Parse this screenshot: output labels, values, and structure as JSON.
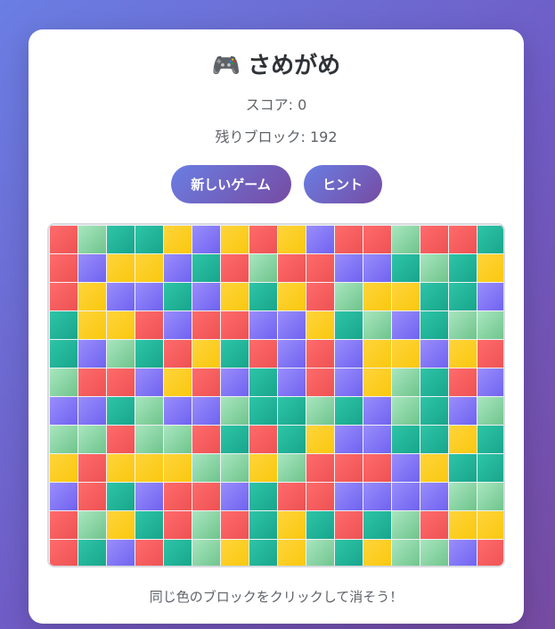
{
  "game": {
    "icon": "🎮",
    "title": "さめがめ",
    "score_text": "スコア: 0",
    "remaining_text": "残りブロック: 192",
    "new_game_label": "新しいゲーム",
    "hint_label": "ヒント",
    "instruction": "同じ色のブロックをクリックして消そう！"
  },
  "colors": {
    "R": "#ee5253",
    "G": "#8fd6a8",
    "T": "#1fb59a",
    "Y": "#fdd02a",
    "P": "#8479f7"
  },
  "board": {
    "rows": 12,
    "cols": 16,
    "grid": [
      "RGTTYPYRYPRRGRRT",
      "RPYYPTRGRRPPTGTY",
      "RYPPTPYTYRGYYTTP",
      "TYYRPRRPPYTGPTGG",
      "TPGTRYTRPRPYYPYR",
      "GRRPYRPTPRPYGTRP",
      "PPTGPPGTTGTPGTPG",
      "GGRGGRTRTYPPTTYT",
      "YRYYYGGYGRRRPYTT",
      "PRTPRRPTRRPPPPGG",
      "RGYTRGRTYTRTGRYY",
      "RTPRTGYTYGTYGGPR"
    ]
  }
}
